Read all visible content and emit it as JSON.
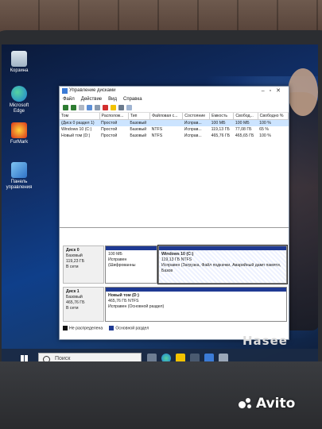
{
  "desktop": {
    "icons": [
      {
        "label": "Корзина",
        "icon": "recycle-bin-icon"
      },
      {
        "label": "Microsoft Edge",
        "icon": "edge-icon"
      },
      {
        "label": "FurMark",
        "icon": "furmark-icon"
      },
      {
        "label": "Панель управления",
        "icon": "control-panel-icon"
      }
    ]
  },
  "window": {
    "title": "Управление дисками",
    "menu": [
      "Файл",
      "Действие",
      "Вид",
      "Справка"
    ],
    "columns": [
      "Том",
      "Располож...",
      "Тип",
      "Файловая с...",
      "Состояние",
      "Емкость",
      "Свобод...",
      "Свободно %"
    ],
    "volumes": [
      [
        "(Диск 0 раздел 1)",
        "Простой",
        "Базовый",
        "",
        "Исправ...",
        "100 МБ",
        "100 МБ",
        "100 %"
      ],
      [
        "Windows 10 (C:)",
        "Простой",
        "Базовый",
        "NTFS",
        "Исправ...",
        "119,13 ГБ",
        "77,08 ГБ",
        "65 %"
      ],
      [
        "Новый том (D:)",
        "Простой",
        "Базовый",
        "NTFS",
        "Исправ...",
        "465,76 ГБ",
        "465,65 ГБ",
        "100 %"
      ]
    ],
    "disks": [
      {
        "name": "Диск 0",
        "type": "Базовый",
        "size": "119,23 ГБ",
        "status": "В сети",
        "partitions": [
          {
            "title": "",
            "size": "100 МБ",
            "status": "Исправен (Шифрованны"
          },
          {
            "title": "Windows 10  (C:)",
            "size": "119,13 ГБ NTFS",
            "status": "Исправен (Загрузка, Файл подкачки, Аварийный дамп памяти, Базов"
          }
        ]
      },
      {
        "name": "Диск 1",
        "type": "Базовый",
        "size": "465,76 ГБ",
        "status": "В сети",
        "partitions": [
          {
            "title": "Новый том  (D:)",
            "size": "465,76 ГБ NTFS",
            "status": "Исправен (Основной раздел)"
          }
        ]
      }
    ],
    "legend": [
      "Не распределена",
      "Основной раздел"
    ]
  },
  "taskbar": {
    "search_placeholder": "Поиск"
  },
  "brand": {
    "laptop": "Hasee",
    "watermark": "Avito"
  },
  "colors": {
    "partition_bar": "#1f3a93",
    "unallocated": "#111111",
    "primary": "#1f3a93"
  }
}
